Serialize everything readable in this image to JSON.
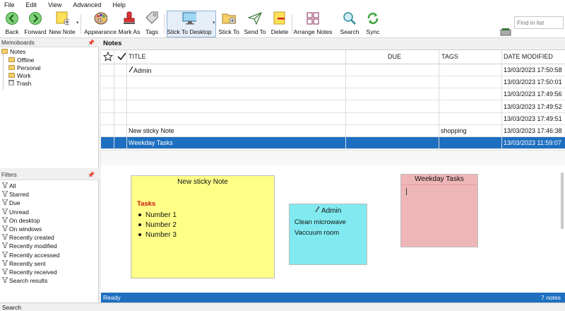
{
  "menu": [
    "File",
    "Edit",
    "View",
    "Advanced",
    "Help"
  ],
  "toolbar": {
    "back": "Back",
    "forward": "Forward",
    "new_note": "New Note",
    "appearance": "Appearance",
    "mark_as": "Mark As",
    "tags": "Tags",
    "stick_to_desktop": "Stick To Desktop",
    "stick_to": "Stick To",
    "send_to": "Send To",
    "delete": "Delete",
    "arrange_notes": "Arrange Notes",
    "search": "Search",
    "sync": "Sync",
    "find_placeholder": "Find in list"
  },
  "memoboards": {
    "title": "Memoboards",
    "items": [
      "Notes",
      "Offline",
      "Personal",
      "Work",
      "Trash"
    ]
  },
  "filters": {
    "title": "Filters",
    "items": [
      "All",
      "Starred",
      "Due",
      "Unread",
      "On desktop",
      "On windows",
      "Recently created",
      "Recently modified",
      "Recently accessed",
      "Recently sent",
      "Recently received",
      "Search results"
    ]
  },
  "notes": {
    "title": "Notes",
    "columns": {
      "title": "TITLE",
      "due": "DUE",
      "tags": "TAGS",
      "date_modified": "DATE MODIFIED"
    },
    "rows": [
      {
        "title": "Admin",
        "has_pen": true,
        "due": "",
        "tags": "",
        "date": "13/03/2023 17:50:58",
        "selected": false
      },
      {
        "title": "",
        "has_pen": false,
        "due": "",
        "tags": "",
        "date": "13/03/2023 17:50:01",
        "selected": false
      },
      {
        "title": "",
        "has_pen": false,
        "due": "",
        "tags": "",
        "date": "13/03/2023 17:49:56",
        "selected": false
      },
      {
        "title": "",
        "has_pen": false,
        "due": "",
        "tags": "",
        "date": "13/03/2023 17:49:52",
        "selected": false
      },
      {
        "title": "",
        "has_pen": false,
        "due": "",
        "tags": "",
        "date": "13/03/2023 17:49:51",
        "selected": false
      },
      {
        "title": "New sticky Note",
        "has_pen": false,
        "due": "",
        "tags": "shopping",
        "date": "13/03/2023 17:46:38",
        "selected": false
      },
      {
        "title": "Weekday Tasks",
        "has_pen": false,
        "due": "",
        "tags": "",
        "date": "13/03/2023 11:59:07",
        "selected": true
      }
    ]
  },
  "stickies": {
    "new_sticky": {
      "title": "New sticky Note",
      "heading": "Tasks",
      "items": [
        "Number 1",
        "Number 2",
        "Number 3"
      ],
      "color": "#ffff88",
      "heading_color": "#cc1111"
    },
    "admin": {
      "title": "Admin",
      "lines": [
        "Clean microwave",
        "Vaccuum room"
      ],
      "color": "#80eaf0"
    },
    "weekday": {
      "title": "Weekday Tasks",
      "color": "#efb6b8"
    }
  },
  "status": {
    "left": "Ready",
    "right": "7 notes"
  },
  "bottom_tab": "Search",
  "colors": {
    "accent": "#1e6fc0"
  }
}
